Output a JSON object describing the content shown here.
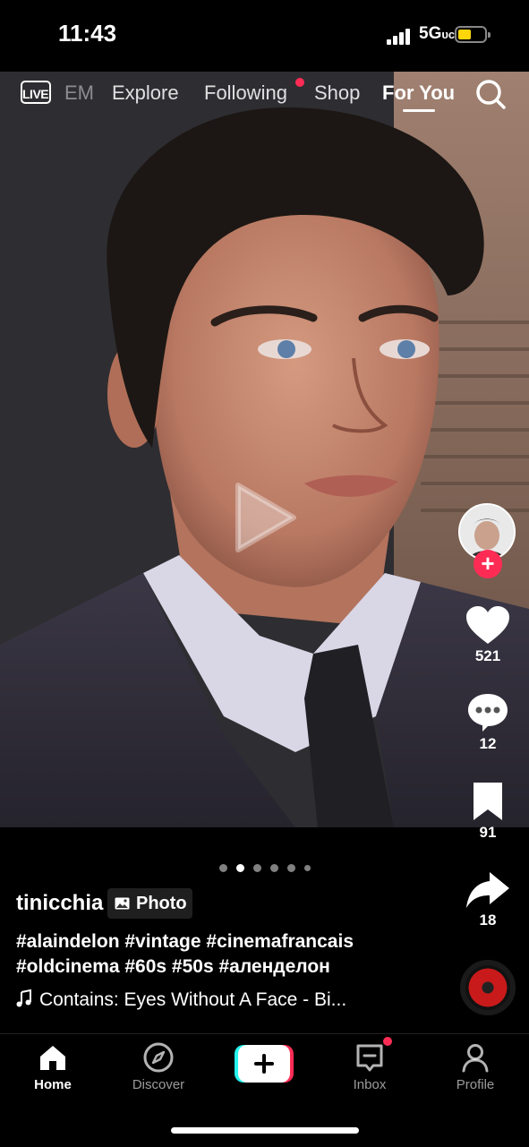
{
  "status_bar": {
    "time": "11:43",
    "network": "5G",
    "network_suffix": "ᴜᴄ",
    "battery_color": "#ffd60a"
  },
  "top_nav": {
    "live_label": "LIVE",
    "faded_item": "EM",
    "items": [
      "Explore",
      "Following",
      "Shop",
      "For You"
    ],
    "active": "For You",
    "notification_dot_color": "#fe2c55",
    "search_icon": "search-icon"
  },
  "post": {
    "username": "tinicchia",
    "type_badge": "Photo",
    "hashtags_line1": "#alaindelon #vintage #cinemafrancais",
    "hashtags_line2": "#oldcinema #60s #50s #аленделон",
    "music": "Contains: Eyes Without A Face - Bi...",
    "carousel_dots": 6,
    "carousel_active_index": 1
  },
  "actions": {
    "likes": "521",
    "comments": "12",
    "saves": "91",
    "shares": "18"
  },
  "bottom_nav": {
    "items": [
      {
        "label": "Home",
        "icon": "home-icon"
      },
      {
        "label": "Discover",
        "icon": "compass-icon"
      },
      {
        "label": "",
        "icon": "create-icon"
      },
      {
        "label": "Inbox",
        "icon": "inbox-icon"
      },
      {
        "label": "Profile",
        "icon": "profile-icon"
      }
    ],
    "active": "Home"
  },
  "colors": {
    "accent": "#fe2c55",
    "create_cyan": "#25f4ee",
    "create_red": "#fe2c55"
  }
}
